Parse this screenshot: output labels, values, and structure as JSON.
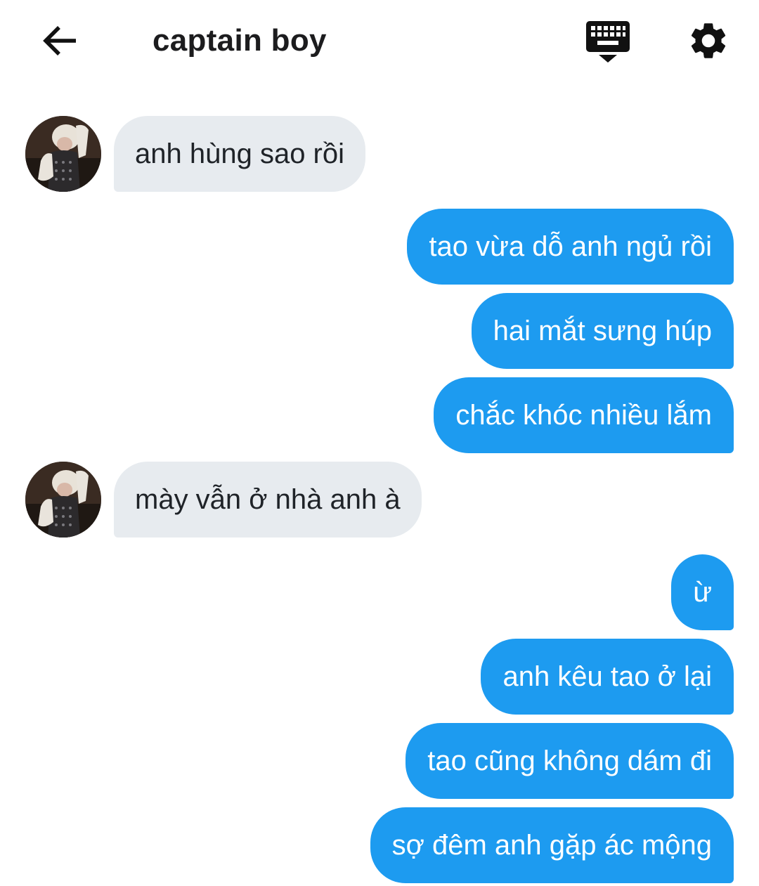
{
  "header": {
    "title": "captain boy",
    "back_icon": "arrow-left-icon",
    "keyboard_icon": "keyboard-hide-icon",
    "settings_icon": "gear-icon"
  },
  "colors": {
    "outgoing_bubble": "#1d9bf0",
    "incoming_bubble": "#e7ebef",
    "outgoing_text": "#ffffff",
    "incoming_text": "#1f2328"
  },
  "messages": [
    {
      "direction": "incoming",
      "text": "anh hùng sao rồi"
    },
    {
      "direction": "outgoing",
      "text": "tao vừa dỗ anh ngủ rồi"
    },
    {
      "direction": "outgoing",
      "text": "hai mắt sưng húp"
    },
    {
      "direction": "outgoing",
      "text": "chắc khóc nhiều lắm"
    },
    {
      "direction": "incoming",
      "text": "mày vẫn ở nhà anh à"
    },
    {
      "direction": "outgoing",
      "text": "ừ"
    },
    {
      "direction": "outgoing",
      "text": "anh kêu tao ở lại"
    },
    {
      "direction": "outgoing",
      "text": "tao cũng không dám đi"
    },
    {
      "direction": "outgoing",
      "text": "sợ đêm anh gặp ác mộng"
    }
  ]
}
